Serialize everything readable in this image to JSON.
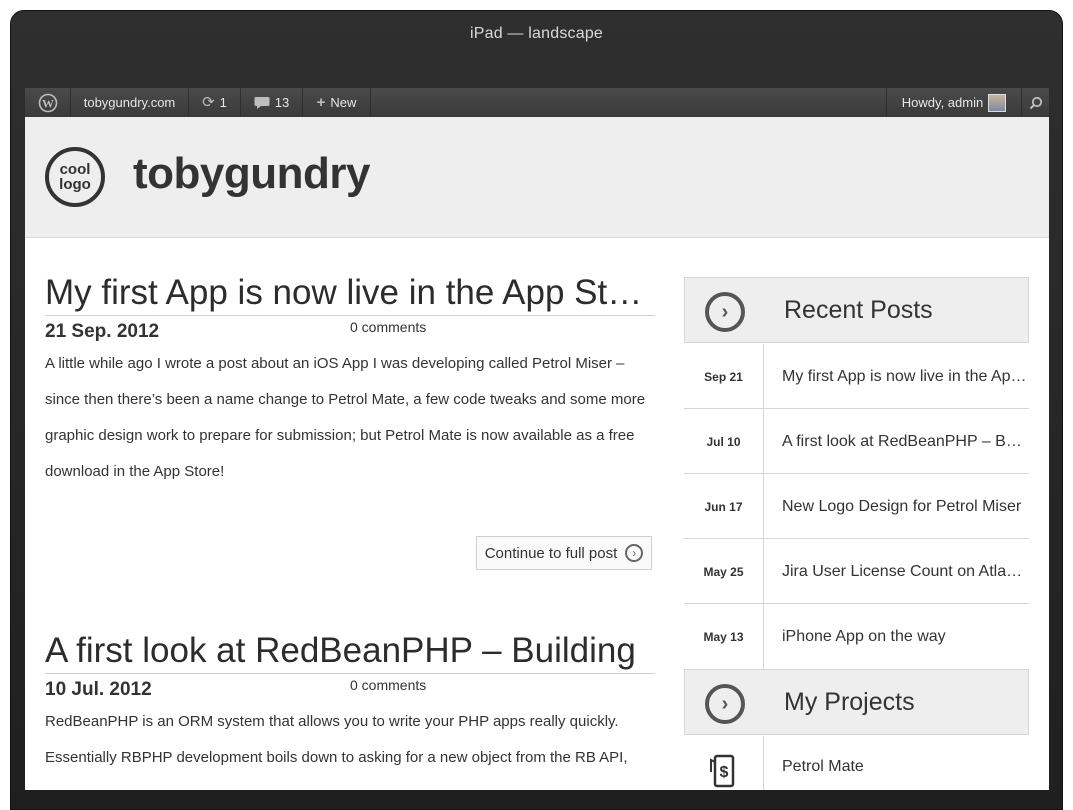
{
  "window": {
    "title": "iPad — landscape"
  },
  "adminbar": {
    "site": "tobygundry.com",
    "updates_count": "1",
    "comments_count": "13",
    "new_label": "New",
    "howdy": "Howdy, admin"
  },
  "header": {
    "logo_line1": "cool",
    "logo_line2": "logo",
    "site_title": "tobygundry"
  },
  "posts": [
    {
      "title": "My first App is now live in the App Store!",
      "date": "21 Sep. 2012",
      "comments": "0 comments",
      "excerpt": "A little while ago I wrote a post about an iOS App I was developing called Petrol Miser – since then there’s been a name change to Petrol Mate, a few code tweaks and some more graphic design work to prepare for submission; but Petrol Mate is now available as a free download in the App Store!",
      "more": "Continue to full post"
    },
    {
      "title": "A first look at RedBeanPHP – Building",
      "date": "10 Jul. 2012",
      "comments": "0 comments",
      "excerpt": "RedBeanPHP is an ORM system that allows you to write your PHP apps really quickly. Essentially RBPHP development boils down to asking for a new object from the RB API,"
    }
  ],
  "sidebar": {
    "recent_title": "Recent Posts",
    "recent": [
      {
        "date": "Sep 21",
        "title": "My first App is now live in the App Store"
      },
      {
        "date": "Jul 10",
        "title": "A first look at RedBeanPHP – Building"
      },
      {
        "date": "Jun 17",
        "title": "New Logo Design for Petrol Miser"
      },
      {
        "date": "May 25",
        "title": "Jira User License Count on Atlassian"
      },
      {
        "date": "May 13",
        "title": "iPhone App on the way"
      }
    ],
    "projects_title": "My Projects",
    "projects": [
      {
        "title": "Petrol Mate"
      }
    ]
  }
}
